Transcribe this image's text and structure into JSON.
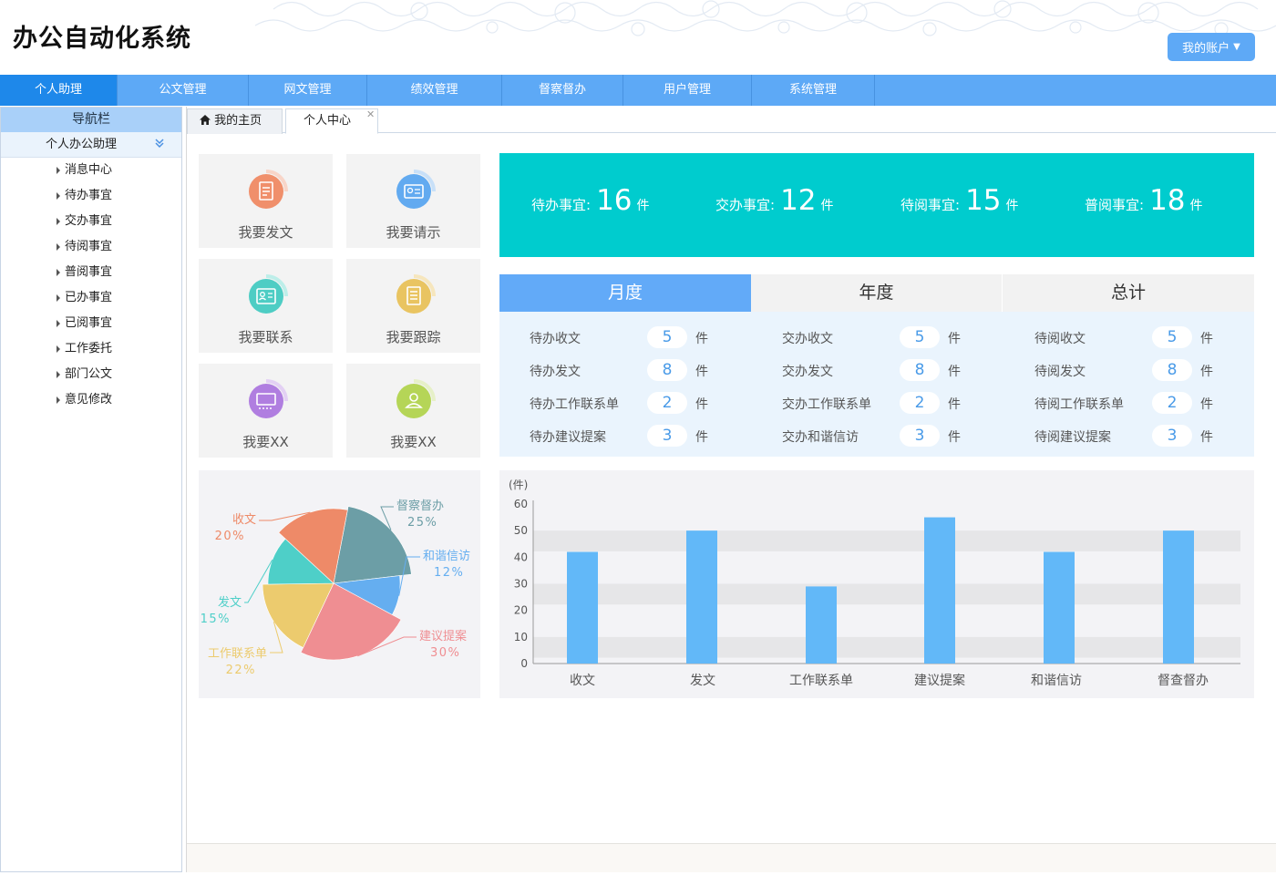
{
  "app": {
    "title": "办公自动化系统",
    "account_label": "我的账户"
  },
  "menu": [
    {
      "label": "个人助理",
      "active": true
    },
    {
      "label": "公文管理"
    },
    {
      "label": "网文管理"
    },
    {
      "label": "绩效管理"
    },
    {
      "label": "督察督办"
    },
    {
      "label": "用户管理"
    },
    {
      "label": "系统管理"
    }
  ],
  "sidebar": {
    "header": "导航栏",
    "group": "个人办公助理",
    "items": [
      "消息中心",
      "待办事宜",
      "交办事宜",
      "待阅事宜",
      "普阅事宜",
      "已办事宜",
      "已阅事宜",
      "工作委托",
      "部门公文",
      "意见修改"
    ]
  },
  "tabs": [
    {
      "label": "我的主页",
      "icon": "home-icon"
    },
    {
      "label": "个人中心",
      "active": true,
      "closable": true
    }
  ],
  "quick": [
    {
      "label": "我要发文",
      "icon": "document-icon",
      "color": "#f08f6b"
    },
    {
      "label": "我要请示",
      "icon": "request-icon",
      "color": "#62aaf0"
    },
    {
      "label": "我要联系",
      "icon": "contact-card-icon",
      "color": "#4ecdc4"
    },
    {
      "label": "我要跟踪",
      "icon": "tracking-list-icon",
      "color": "#e9c461"
    },
    {
      "label": "我要XX",
      "icon": "presentation-icon",
      "color": "#b07ee0"
    },
    {
      "label": "我要XX",
      "icon": "user-icon",
      "color": "#b5d557"
    }
  ],
  "summary": [
    {
      "label": "待办事宜:",
      "value": "16",
      "unit": "件"
    },
    {
      "label": "交办事宜:",
      "value": "12",
      "unit": "件"
    },
    {
      "label": "待阅事宜:",
      "value": "15",
      "unit": "件"
    },
    {
      "label": "普阅事宜:",
      "value": "18",
      "unit": "件"
    }
  ],
  "period_tabs": [
    {
      "label": "月度",
      "active": true
    },
    {
      "label": "年度"
    },
    {
      "label": "总计"
    }
  ],
  "stats": [
    [
      {
        "label": "待办收文",
        "value": "5",
        "unit": "件"
      },
      {
        "label": "待办发文",
        "value": "8",
        "unit": "件"
      },
      {
        "label": "待办工作联系单",
        "value": "2",
        "unit": "件"
      },
      {
        "label": "待办建议提案",
        "value": "3",
        "unit": "件"
      }
    ],
    [
      {
        "label": "交办收文",
        "value": "5",
        "unit": "件"
      },
      {
        "label": "交办发文",
        "value": "8",
        "unit": "件"
      },
      {
        "label": "交办工作联系单",
        "value": "2",
        "unit": "件"
      },
      {
        "label": "交办和谐信访",
        "value": "3",
        "unit": "件"
      }
    ],
    [
      {
        "label": "待阅收文",
        "value": "5",
        "unit": "件"
      },
      {
        "label": "待阅发文",
        "value": "8",
        "unit": "件"
      },
      {
        "label": "待阅工作联系单",
        "value": "2",
        "unit": "件"
      },
      {
        "label": "待阅建议提案",
        "value": "3",
        "unit": "件"
      }
    ]
  ],
  "chart_data": [
    {
      "type": "pie",
      "slices": [
        {
          "name": "督察督办",
          "value": 25,
          "label": "25%",
          "color": "#6c9ea6"
        },
        {
          "name": "和谐信访",
          "value": 12,
          "label": "12%",
          "color": "#65aef0"
        },
        {
          "name": "建议提案",
          "value": 30,
          "label": "30%",
          "color": "#ef8e92"
        },
        {
          "name": "工作联系单",
          "value": 22,
          "label": "22%",
          "color": "#eccb6e"
        },
        {
          "name": "发文",
          "value": 15,
          "label": "15%",
          "color": "#4ecfc8"
        },
        {
          "name": "收文",
          "value": 20,
          "label": "20%",
          "color": "#ee8a68"
        }
      ]
    },
    {
      "type": "bar",
      "ylabel": "(件)",
      "ylim": [
        0,
        60
      ],
      "yticks": [
        0,
        10,
        20,
        30,
        40,
        50,
        60
      ],
      "categories": [
        "收文",
        "发文",
        "工作联系单",
        "建议提案",
        "和谐信访",
        "督查督办"
      ],
      "values": [
        42,
        50,
        29,
        55,
        42,
        50
      ],
      "grid": "alternating bands",
      "color": "#62b8f8"
    }
  ]
}
